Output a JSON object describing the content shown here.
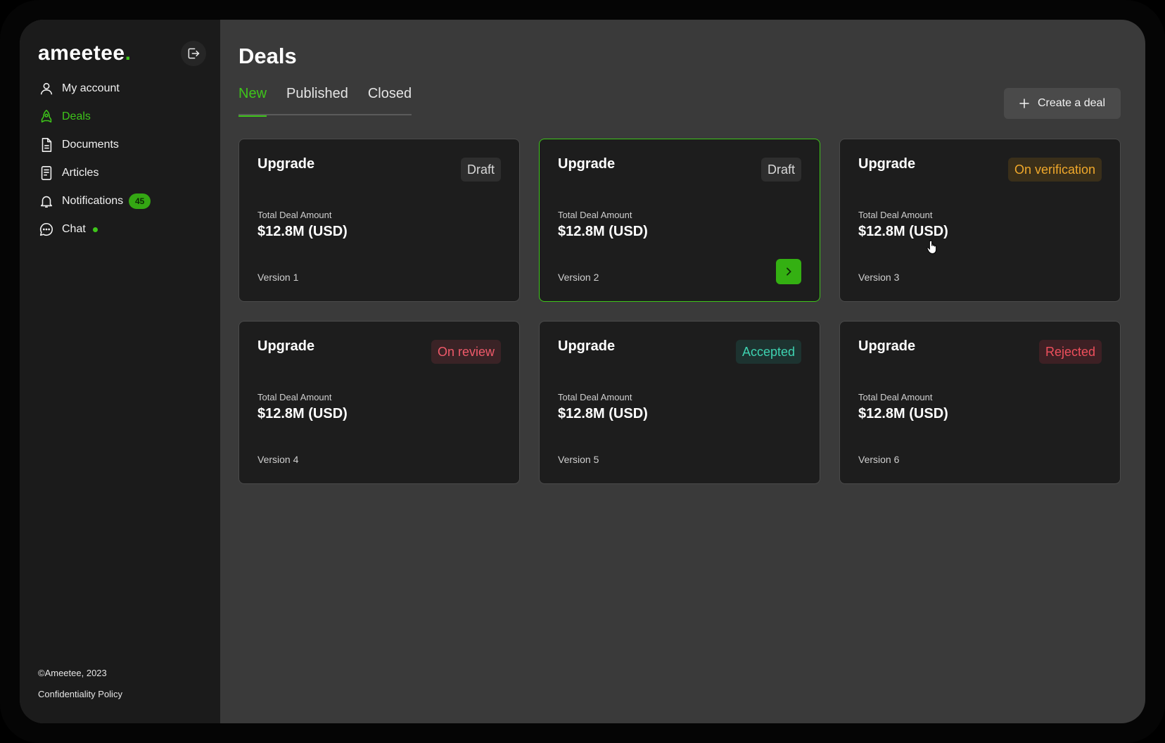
{
  "brand": {
    "name": "ameetee",
    "dot": "."
  },
  "sidebar": {
    "items": [
      {
        "label": "My account",
        "icon": "user-icon",
        "active": false
      },
      {
        "label": "Deals",
        "icon": "rocket-icon",
        "active": true
      },
      {
        "label": "Documents",
        "icon": "document-icon",
        "active": false
      },
      {
        "label": "Articles",
        "icon": "article-icon",
        "active": false
      },
      {
        "label": "Notifications",
        "icon": "bell-icon",
        "badge": "45",
        "active": false
      },
      {
        "label": "Chat",
        "icon": "chat-icon",
        "online": true,
        "active": false
      }
    ],
    "footer": {
      "copyright": "©Ameetee, 2023",
      "policy": "Confidentiality Policy"
    }
  },
  "page": {
    "title": "Deals"
  },
  "tabs": [
    {
      "label": "New",
      "active": true
    },
    {
      "label": "Published",
      "active": false
    },
    {
      "label": "Closed",
      "active": false
    }
  ],
  "create_button": {
    "label": "Create a deal"
  },
  "deals": [
    {
      "title": "Upgrade",
      "status": "Draft",
      "amount_label": "Total Deal Amount",
      "amount": "$12.8M (USD)",
      "version": "Version 1"
    },
    {
      "title": "Upgrade",
      "status": "Draft",
      "amount_label": "Total Deal Amount",
      "amount": "$12.8M (USD)",
      "version": "Version 2"
    },
    {
      "title": "Upgrade",
      "status": "On verification",
      "amount_label": "Total Deal Amount",
      "amount": "$12.8M (USD)",
      "version": "Version 3"
    },
    {
      "title": "Upgrade",
      "status": "On review",
      "amount_label": "Total Deal Amount",
      "amount": "$12.8M (USD)",
      "version": "Version 4"
    },
    {
      "title": "Upgrade",
      "status": "Accepted",
      "amount_label": "Total Deal Amount",
      "amount": "$12.8M (USD)",
      "version": "Version 5"
    },
    {
      "title": "Upgrade",
      "status": "Rejected",
      "amount_label": "Total Deal Amount",
      "amount": "$12.8M (USD)",
      "version": "Version 6"
    }
  ],
  "colors": {
    "accent": "#3ec51a",
    "sidebar_bg": "#1b1b1b",
    "main_bg": "#3a3a3a",
    "card_bg": "#1d1d1d",
    "status_verification": "#f0a82b",
    "status_review": "#ef5a6a",
    "status_accepted": "#3ed2b0",
    "status_rejected": "#ee4f5c"
  }
}
